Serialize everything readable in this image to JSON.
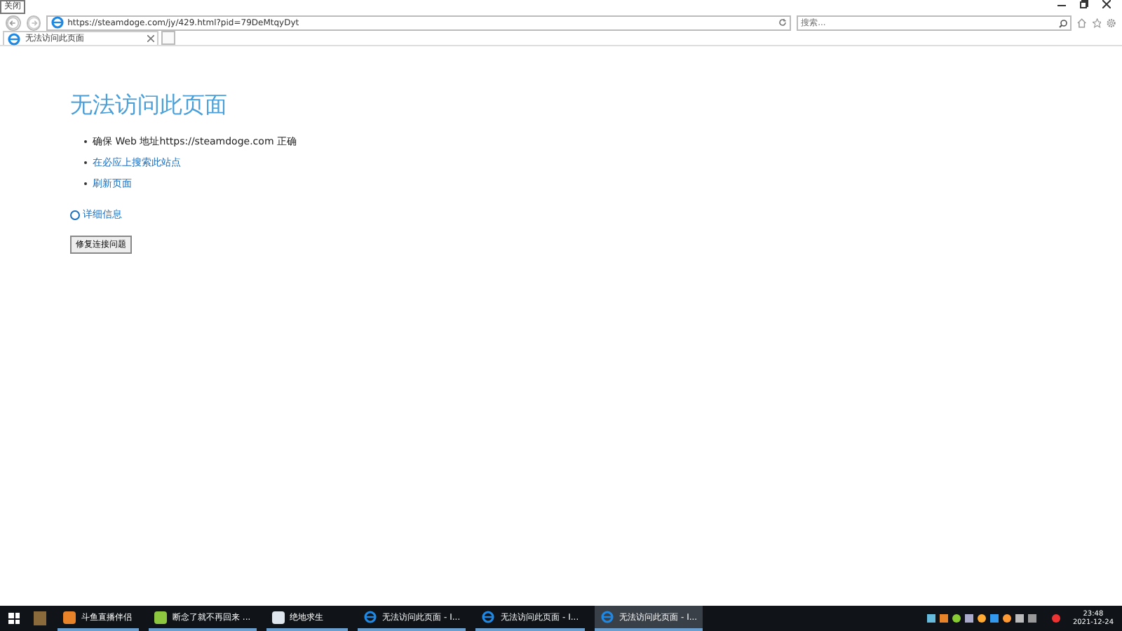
{
  "tooltip": "关闭",
  "address_bar": {
    "url": "https://steamdoge.com/jy/429.html?pid=79DeMtqyDyt"
  },
  "search": {
    "placeholder": "搜索..."
  },
  "tabs": [
    {
      "label": "无法访问此页面",
      "selected": true
    }
  ],
  "page": {
    "title": "无法访问此页面",
    "items": [
      {
        "kind": "text",
        "text": "确保 Web 地址https://steamdoge.com 正确"
      },
      {
        "kind": "link",
        "text": "在必应上搜索此站点"
      },
      {
        "kind": "link",
        "text": "刷新页面"
      }
    ],
    "details": "详细信息",
    "button": "修复连接问题"
  },
  "taskbar": {
    "apps": [
      {
        "label": "斗鱼直播伴侣",
        "kind": "app",
        "selected": false
      },
      {
        "label": "断念了就不再回来 ...",
        "kind": "app",
        "selected": false
      },
      {
        "label": "绝地求生",
        "kind": "app",
        "selected": false
      },
      {
        "label": "无法访问此页面 - I...",
        "kind": "browser",
        "selected": false
      },
      {
        "label": "无法访问此页面 - I...",
        "kind": "browser",
        "selected": false
      },
      {
        "label": "无法访问此页面 - I...",
        "kind": "browser",
        "selected": true
      }
    ],
    "time": "23:48",
    "date": "2021-12-24"
  }
}
